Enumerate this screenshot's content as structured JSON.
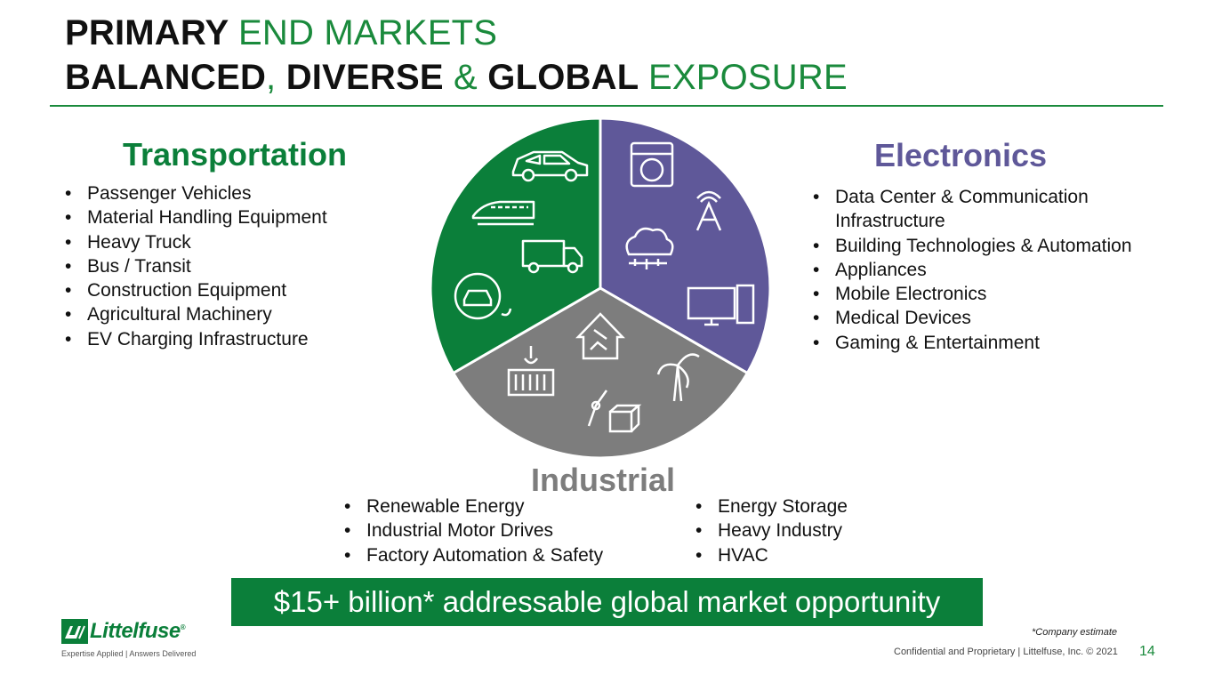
{
  "title": {
    "line1_bold": "PRIMARY",
    "line1_rest": "END MARKETS",
    "line2_b1": "BALANCED",
    "line2_s1": ",",
    "line2_b2": "DIVERSE",
    "line2_s2": "&",
    "line2_b3": "GLOBAL",
    "line2_rest": "EXPOSURE"
  },
  "colors": {
    "green": "#0b7f3a",
    "purple": "#5f5899",
    "gray": "#7d7d7d",
    "accent_green": "#1a8a3c"
  },
  "transportation": {
    "heading": "Transportation",
    "items": [
      "Passenger Vehicles",
      "Material Handling Equipment",
      "Heavy Truck",
      "Bus / Transit",
      "Construction Equipment",
      "Agricultural Machinery",
      "EV Charging Infrastructure"
    ],
    "icons": [
      "car-icon",
      "train-icon",
      "truck-icon",
      "ev-charging-icon"
    ]
  },
  "electronics": {
    "heading": "Electronics",
    "items": [
      "Data Center & Communication Infrastructure",
      "Building Technologies & Automation",
      "Appliances",
      "Mobile Electronics",
      "Medical Devices",
      "Gaming & Entertainment"
    ],
    "icons": [
      "washing-machine-icon",
      "antenna-tower-icon",
      "cloud-network-icon",
      "desktop-computer-icon"
    ]
  },
  "industrial": {
    "heading": "Industrial",
    "items_left": [
      "Renewable Energy",
      "Industrial Motor Drives",
      "Factory Automation & Safety"
    ],
    "items_right": [
      "Energy Storage",
      "Heavy Industry",
      "HVAC"
    ],
    "icons": [
      "smart-home-icon",
      "wind-turbine-icon",
      "crane-container-icon",
      "robot-arm-icon"
    ]
  },
  "banner": "$15+ billion* addressable global market opportunity",
  "footnote": "*Company estimate",
  "footer": "Confidential and Proprietary | Littelfuse, Inc. © 2021",
  "page_number": "14",
  "logo": {
    "word": "Littelfuse",
    "reg": "®",
    "tagline": "Expertise Applied | Answers Delivered"
  }
}
